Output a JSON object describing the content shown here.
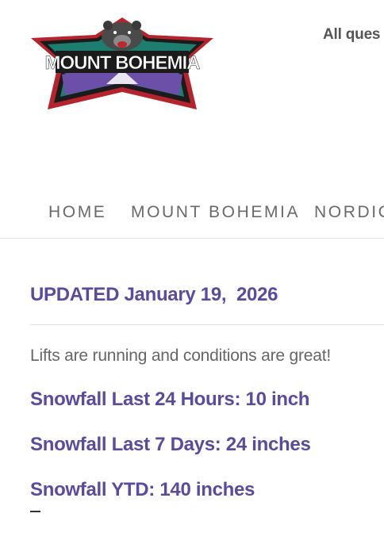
{
  "header": {
    "logo_alt": "MOUNT BOHEMIA",
    "note": "All ques"
  },
  "nav": {
    "items": [
      "HOME",
      "MOUNT BOHEMIA",
      "NORDIC"
    ]
  },
  "report": {
    "updated": "UPDATED January 19,  2026",
    "status": "Lifts are running and conditions are great!",
    "snow_24h": "Snowfall Last 24 Hours: 10 inch",
    "snow_7d": "Snowfall Last 7 Days: 24 inches",
    "snow_ytd": "Snowfall YTD: 140 inches"
  },
  "colors": {
    "accent": "#5b4a9e",
    "logo_teal": "#1d7d6e",
    "logo_red": "#b5232d",
    "logo_purple": "#6c4fa8"
  },
  "icons": {
    "logo": "bear-mountain-logo"
  }
}
